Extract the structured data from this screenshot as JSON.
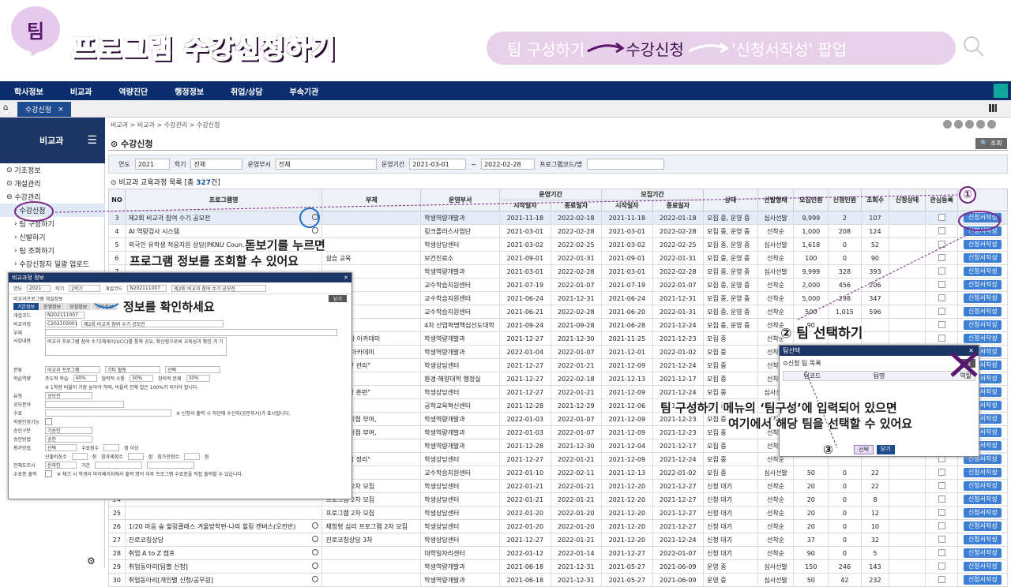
{
  "banner": {
    "badge": "팀",
    "title": "프로그램 수강신청하기",
    "flow": [
      "팀 구성하기",
      "수강신청",
      "'신청서작성' 팝업"
    ]
  },
  "topnav": [
    "학사정보",
    "비교과",
    "역량진단",
    "행정정보",
    "취업/상담",
    "부속기관"
  ],
  "tab": {
    "label": "수강신청",
    "close": "×"
  },
  "sidebar": {
    "header": "비교과",
    "items": [
      {
        "label": "기초정보"
      },
      {
        "label": "개설관리"
      },
      {
        "label": "수강관리"
      },
      {
        "label": "수강신청"
      },
      {
        "label": "팀 구성하기"
      },
      {
        "label": "신발하기"
      },
      {
        "label": "팀 조회하기"
      },
      {
        "label": "수강신청자 일괄 업로드"
      }
    ]
  },
  "breadcrumb": "비교과 > 비교과 > 수강관리 > 수강신청",
  "page_title": "수강신청",
  "search_button": "조회",
  "filter": {
    "year_label": "연도",
    "year": "2021",
    "term_label": "학기",
    "term": "전체",
    "dept_label": "운영부서",
    "dept": "전체",
    "period_label": "운영기간",
    "start": "2021-03-01",
    "tilde": "~",
    "end": "2022-02-28",
    "code_label": "프로그램코드/명"
  },
  "list_title": {
    "prefix": "비교과 교육과정 목록 [총",
    "count": "327",
    "suffix": "건]"
  },
  "columns": {
    "no": "NO",
    "name": "프로그램명",
    "sub": "부제",
    "dept": "운영부서",
    "op": "운영기간",
    "rec": "모집기간",
    "start": "시작일자",
    "end": "종료일자",
    "state": "상태",
    "sel": "선발형태",
    "cap": "모집인원",
    "appl": "신청인원",
    "views": "조회수",
    "astate": "신청상태",
    "fav": "관심등록"
  },
  "apply_label": "신청서작성",
  "rows": [
    {
      "no": "3",
      "name": "제2회 비교과 참여 수기 공모전",
      "sub": "",
      "dept": "학생역량개발과",
      "os": "2021-11-18",
      "oe": "2022-02-18",
      "rs": "2021-11-18",
      "re": "2022-01-18",
      "state": "모집 중, 운영 중",
      "sel": "심사선발",
      "cap": "9,999",
      "appl": "2",
      "views": "107"
    },
    {
      "no": "4",
      "name": "AI 역량검사 시스템",
      "sub": "",
      "dept": "링크플러스사업단",
      "os": "2021-03-01",
      "oe": "2022-02-28",
      "rs": "2021-03-01",
      "re": "2022-02-28",
      "state": "모집 중, 운영 중",
      "sel": "선착순",
      "cap": "1,000",
      "appl": "208",
      "views": "124"
    },
    {
      "no": "5",
      "name": "외국인 유학생 적응지원 상담(PKNU Coun...",
      "sub": "",
      "dept": "학생상담센터",
      "os": "2021-03-02",
      "oe": "2022-02-25",
      "rs": "2021-03-02",
      "re": "2022-02-25",
      "state": "모집 중, 운영 중",
      "sel": "심사선발",
      "cap": "1,618",
      "appl": "0",
      "views": "52"
    },
    {
      "no": "6",
      "name": "",
      "sub": "실습 교육",
      "dept": "보건진료소",
      "os": "2021-09-01",
      "oe": "2022-01-31",
      "rs": "2021-09-01",
      "re": "2022-01-31",
      "state": "모집 중, 운영 중",
      "sel": "선착순",
      "cap": "100",
      "appl": "0",
      "views": "90"
    },
    {
      "no": "7",
      "name": "",
      "sub": "",
      "dept": "학생역량개발과",
      "os": "2021-03-01",
      "oe": "2022-02-28",
      "rs": "2021-03-01",
      "re": "2022-02-28",
      "state": "모집 중, 운영 중",
      "sel": "심사선발",
      "cap": "9,999",
      "appl": "328",
      "views": "393"
    },
    {
      "no": "8",
      "name": "",
      "sub": "",
      "dept": "교수학습지원센터",
      "os": "2021-07-19",
      "oe": "2022-01-07",
      "rs": "2021-07-19",
      "re": "2022-01-07",
      "state": "모집 중, 운영 중",
      "sel": "선착순",
      "cap": "2,000",
      "appl": "456",
      "views": "206"
    },
    {
      "no": "9",
      "name": "",
      "sub": "",
      "dept": "교수학습지원센터",
      "os": "2021-06-24",
      "oe": "2021-12-31",
      "rs": "2021-06-24",
      "re": "2021-12-31",
      "state": "모집 중, 운영 중",
      "sel": "선착순",
      "cap": "5,000",
      "appl": "298",
      "views": "347"
    },
    {
      "no": "10",
      "name": "",
      "sub": "",
      "dept": "교수학습지원센터",
      "os": "2021-06-21",
      "oe": "2022-02-28",
      "rs": "2021-06-20",
      "re": "2022-01-31",
      "state": "모집 중, 운영 중",
      "sel": "선착순",
      "cap": "500",
      "appl": "1,015",
      "views": "596"
    },
    {
      "no": "11",
      "name": "",
      "sub": "",
      "dept": "4차 산업혁명핵심선도대학",
      "os": "2021-09-24",
      "oe": "2021-09-28",
      "rs": "2021-06-28",
      "re": "2021-12-24",
      "state": "모집 중, 운영 중",
      "sel": "선착순",
      "cap": "90",
      "appl": "",
      "views": ""
    },
    {
      "no": "12",
      "name": "",
      "sub": "업역량강화 아카데미",
      "dept": "학생역량개발과",
      "os": "2021-12-27",
      "oe": "2021-12-30",
      "rs": "2021-11-25",
      "re": "2021-12-23",
      "state": "모집 중",
      "sel": "선착순",
      "cap": "",
      "appl": "",
      "views": ""
    },
    {
      "no": "13",
      "name": "",
      "sub": "진로지도 아카데미",
      "dept": "학생역량개발과",
      "os": "2022-01-04",
      "oe": "2022-01-07",
      "rs": "2021-12-01",
      "re": "2022-01-02",
      "state": "모집 중",
      "sel": "선착순",
      "cap": "",
      "appl": "",
      "views": ""
    },
    {
      "no": "14",
      "name": "",
      "sub": "시작 \"시간 관리\"",
      "dept": "학생상담센터",
      "os": "2021-12-27",
      "oe": "2022-01-21",
      "rs": "2021-12-09",
      "re": "2021-12-24",
      "state": "모집 중",
      "sel": "선착순",
      "cap": "",
      "appl": "",
      "views": ""
    },
    {
      "no": "15",
      "name": "",
      "sub": "",
      "dept": "환경·해양대학 행정실",
      "os": "2021-12-27",
      "oe": "2022-02-18",
      "rs": "2021-12-13",
      "re": "2021-12-17",
      "state": "모집 중",
      "sel": "선착순",
      "cap": "",
      "appl": "",
      "views": ""
    },
    {
      "no": "16",
      "name": "",
      "sub": "명서 \"감정 훈련\"",
      "dept": "학생상담센터",
      "os": "2021-12-27",
      "oe": "2022-01-21",
      "rs": "2021-12-09",
      "re": "2021-12-24",
      "state": "모집 중",
      "sel": "심사선발",
      "cap": "",
      "appl": "",
      "views": ""
    },
    {
      "no": "17",
      "name": "",
      "sub": "",
      "dept": "공학교육혁신센터",
      "os": "2021-12-28",
      "oe": "2021-12-29",
      "rs": "2021-12-06",
      "re": "2021-12-19",
      "state": "모집 중",
      "sel": "선착순",
      "cap": "",
      "appl": "",
      "views": ""
    },
    {
      "no": "18",
      "name": "",
      "sub": "교과목 1학점 부여,",
      "dept": "학생역량개발과",
      "os": "2022-01-03",
      "oe": "2022-01-07",
      "rs": "2021-12-09",
      "re": "2021-12-23",
      "state": "모집 중",
      "sel": "선착순",
      "cap": "",
      "appl": "",
      "views": ""
    },
    {
      "no": "19",
      "name": "",
      "sub": "교과목 1학점 부여,",
      "dept": "학생역량개발과",
      "os": "2022-01-03",
      "oe": "2022-01-07",
      "rs": "2021-12-09",
      "re": "2021-12-23",
      "state": "모집 중",
      "sel": "선착순",
      "cap": "",
      "appl": "",
      "views": ""
    },
    {
      "no": "20",
      "name": "",
      "sub": "",
      "dept": "학생역량개발과",
      "os": "2021-12-28",
      "oe": "2021-12-30",
      "rs": "2021-12-04",
      "re": "2021-12-17",
      "state": "모집 중",
      "sel": "선착순",
      "cap": "",
      "appl": "",
      "views": ""
    },
    {
      "no": "21",
      "name": "",
      "sub": "위한 \"생각 정리\"",
      "dept": "학생상담센터",
      "os": "2021-12-27",
      "oe": "2022-01-21",
      "rs": "2021-12-09",
      "re": "2021-12-24",
      "state": "모집 중",
      "sel": "선착순",
      "cap": "",
      "appl": "",
      "views": ""
    },
    {
      "no": "22",
      "name": "",
      "sub": "",
      "dept": "교수학습지원센터",
      "os": "2022-01-10",
      "oe": "2022-02-11",
      "rs": "2021-12-13",
      "re": "2022-01-02",
      "state": "모집 중",
      "sel": "심사선발",
      "cap": "50",
      "appl": "0",
      "views": "22"
    },
    {
      "no": "23",
      "name": "",
      "sub": "프로그램 2차 모집",
      "dept": "학생상담센터",
      "os": "2022-01-21",
      "oe": "2022-01-21",
      "rs": "2021-12-20",
      "re": "2021-12-27",
      "state": "신청 대기",
      "sel": "선착순",
      "cap": "20",
      "appl": "0",
      "views": "22"
    },
    {
      "no": "24",
      "name": "",
      "sub": "프로그램 2차 모집",
      "dept": "학생상담센터",
      "os": "2022-01-21",
      "oe": "2022-01-21",
      "rs": "2021-12-20",
      "re": "2021-12-27",
      "state": "신청 대기",
      "sel": "선착순",
      "cap": "20",
      "appl": "0",
      "views": "8"
    },
    {
      "no": "25",
      "name": "",
      "sub": "프로그램 2차 모집",
      "dept": "학생상담센터",
      "os": "2022-01-20",
      "oe": "2022-01-20",
      "rs": "2021-12-20",
      "re": "2021-12-27",
      "state": "신청 대기",
      "sel": "선착순",
      "cap": "20",
      "appl": "0",
      "views": "12"
    },
    {
      "no": "26",
      "name": "1/20 마음 숲 힐링클래스 겨울방학편-나의 힐링 캔버스(오전반)",
      "sub": "체험형 심리 프로그램 2차 모집",
      "dept": "학생상담센터",
      "os": "2022-01-20",
      "oe": "2022-01-20",
      "rs": "2021-12-20",
      "re": "2021-12-27",
      "state": "신청 대기",
      "sel": "선착순",
      "cap": "20",
      "appl": "0",
      "views": "10"
    },
    {
      "no": "27",
      "name": "진로코칭상담",
      "sub": "진로코칭상담 3차",
      "dept": "학생상담센터",
      "os": "2021-12-27",
      "oe": "2022-01-21",
      "rs": "2021-12-20",
      "re": "2021-12-24",
      "state": "신청 대기",
      "sel": "선착순",
      "cap": "37",
      "appl": "0",
      "views": "32"
    },
    {
      "no": "28",
      "name": "취업 A to Z 캠프",
      "sub": "",
      "dept": "대학일자리센터",
      "os": "2022-01-12",
      "oe": "2022-01-14",
      "rs": "2021-12-27",
      "re": "2022-01-07",
      "state": "신청 대기",
      "sel": "선착순",
      "cap": "90",
      "appl": "0",
      "views": "5"
    },
    {
      "no": "29",
      "name": "취업동아리[팀별 신청]",
      "sub": "",
      "dept": "학생역량개발과",
      "os": "2021-06-18",
      "oe": "2021-12-31",
      "rs": "2021-05-27",
      "re": "2021-06-09",
      "state": "운영 중",
      "sel": "심사선발",
      "cap": "150",
      "appl": "246",
      "views": "143"
    },
    {
      "no": "30",
      "name": "취업동아리[개인별 신청/공무원]",
      "sub": "",
      "dept": "학생역량개발과",
      "os": "2021-06-18",
      "oe": "2021-12-31",
      "rs": "2021-05-27",
      "re": "2021-06-09",
      "state": "운영 중",
      "sel": "심사선발",
      "cap": "50",
      "appl": "42",
      "views": "232"
    }
  ],
  "popup_info": {
    "title": "비교과정 정보",
    "year_label": "연도",
    "year": "2021",
    "term_label": "학기",
    "term": "2학기",
    "code_label": "개설코드",
    "code": "N202111007",
    "name_val": "제2회 비교과 참여 수기 공모전",
    "section": "비교과프로그램 개설정보",
    "tabs": [
      "기본정보",
      "운영정보",
      "모집정보",
      "기타정보"
    ],
    "close": "닫기",
    "open_code_label": "개설코드",
    "open_code": "N202111007",
    "course_label": "비교과정",
    "course_code": "C202103001",
    "course_name": "제2회 비교과 참여 수기 공모전",
    "sub_label": "부제",
    "desc_label": "사업내용",
    "desc": "비교과 프로그램 참여 수기(체세이/UCC)를 통해 공유, 확산함으로써 교육성과 확인 겨 기",
    "field_label": "분류",
    "field": "비교과 프로그램",
    "act": "기타 활동",
    "sel": "선택",
    "ratio_label": "학습역량",
    "r1": "주도적 학습",
    "p1": "40%",
    "r2": "협력적 소통",
    "p2": "30%",
    "r3": "창의적 문제",
    "p3": "30%",
    "note": "※ 1학량 비율이 가장 높아야 하며, 비율의 전체 합은 100%가 되어야 합니다.",
    "type_label": "유형",
    "type": "공모전",
    "target_label": "공모분야",
    "check_label": "수료",
    "check_note": "※ 신청서 출력 시 하단에 수신자(공문부서)가 표시됩니다.",
    "credit_label": "학점인정기능",
    "grade_label": "승인구분",
    "grade": "기승인",
    "approve_label": "승인방법",
    "approve": "승인",
    "eval_label": "평가방법",
    "eval": "선택",
    "eval2": "수료점수",
    "eval3": "점 이상",
    "score_label": "산출비점수",
    "score1": "점",
    "score2": "참과제점수",
    "score3": "점",
    "score4": "참가만점수",
    "score5": "점",
    "op_label": "전체도조사",
    "op": "온라인",
    "period": "기간",
    "print_label": "수료증 출력",
    "print_note": "※ 체크 시 학생이 마이페이지에서 출력 명의 이후 프로그램 수료증을 직접 출력할 수 있습니다."
  },
  "popup_team": {
    "title": "팀선택",
    "list": "신청 팀 목록",
    "cols": [
      "팀코드",
      "팀명",
      "역할"
    ],
    "select": "선택",
    "close": "닫기",
    "btn": "개"
  },
  "callouts": {
    "magnifier_line1": "돋보기를 누르면",
    "magnifier_line2": "프로그램 정보를 조회할 수 있어요",
    "info": "정보를 확인하세요",
    "step1": "①",
    "step2": "② 팀 선택하기",
    "step3": "③",
    "team_line1": "팀 구성하기 메뉴의 ‘팀구성’에 입력되어 있으면",
    "team_line2": "여기에서 해당 팀을 선택할 수 있어요"
  },
  "colors": {
    "nav": "#0b2e6e",
    "accent": "#6b1d7a",
    "apply": "#3e7fd6"
  }
}
